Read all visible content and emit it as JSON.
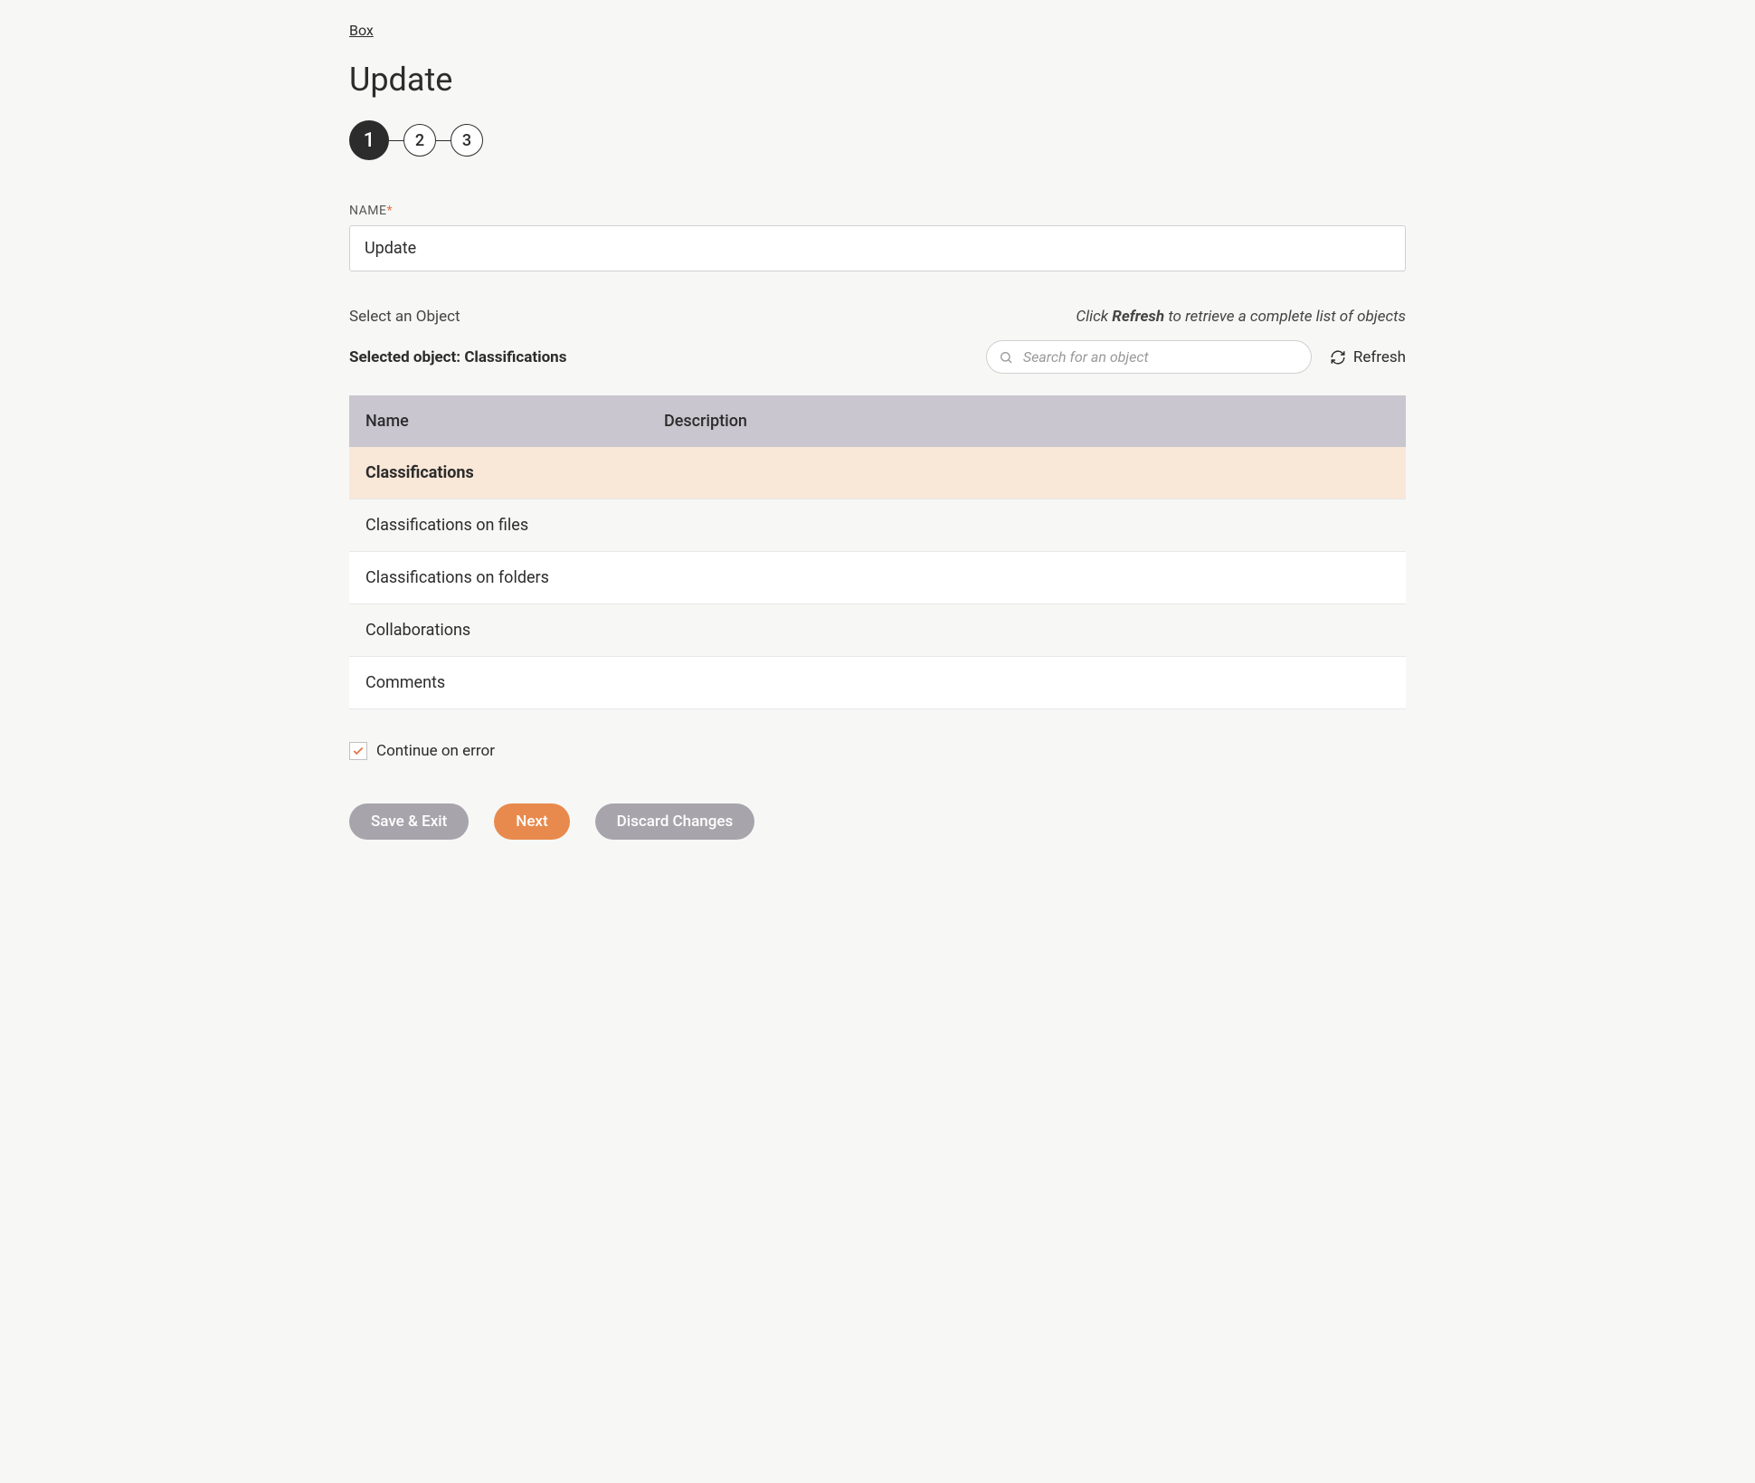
{
  "breadcrumb": "Box",
  "page_title": "Update",
  "stepper": {
    "steps": [
      "1",
      "2",
      "3"
    ],
    "active_index": 0
  },
  "form": {
    "name_label": "NAME",
    "name_value": "Update"
  },
  "section": {
    "select_label": "Select an Object",
    "hint_prefix": "Click ",
    "hint_bold": "Refresh",
    "hint_suffix": " to retrieve a complete list of objects",
    "selected_prefix": "Selected object: ",
    "selected_value": "Classifications",
    "search_placeholder": "Search for an object",
    "refresh_label": "Refresh"
  },
  "table": {
    "headers": [
      "Name",
      "Description"
    ],
    "rows": [
      {
        "name": "Classifications",
        "description": "",
        "selected": true
      },
      {
        "name": "Classifications on files",
        "description": "",
        "selected": false
      },
      {
        "name": "Classifications on folders",
        "description": "",
        "selected": false
      },
      {
        "name": "Collaborations",
        "description": "",
        "selected": false
      },
      {
        "name": "Comments",
        "description": "",
        "selected": false
      }
    ]
  },
  "checkbox": {
    "label": "Continue on error",
    "checked": true
  },
  "buttons": {
    "save_exit": "Save & Exit",
    "next": "Next",
    "discard": "Discard Changes"
  }
}
